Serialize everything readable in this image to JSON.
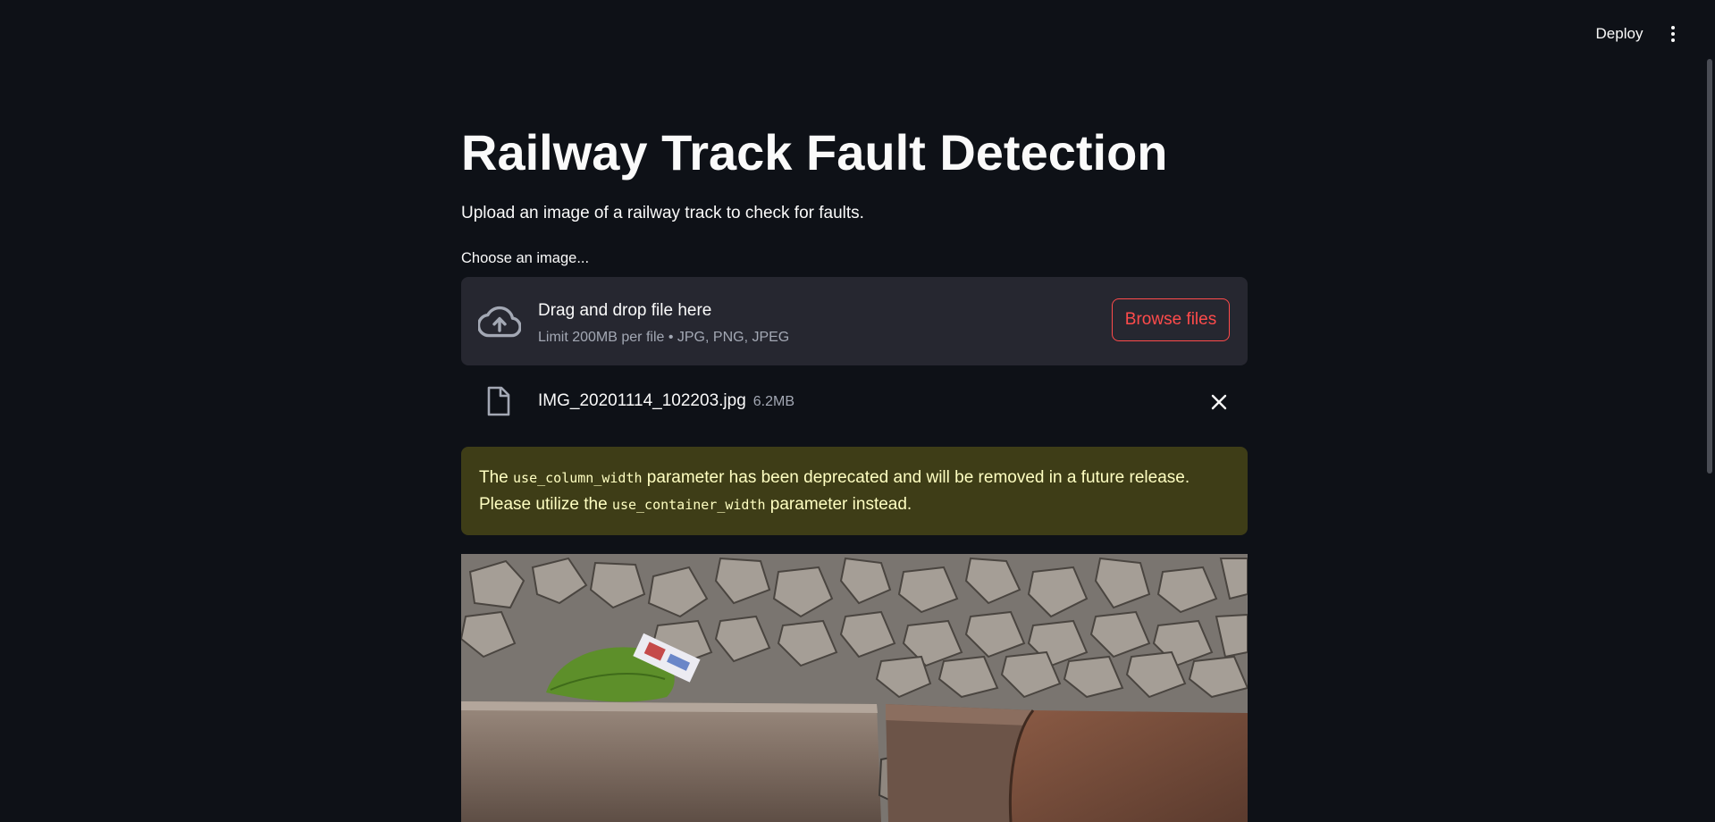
{
  "header": {
    "deploy_label": "Deploy",
    "menu_icon": "more-vertical-icon"
  },
  "page": {
    "title": "Railway Track Fault Detection",
    "subtitle": "Upload an image of a railway track to check for faults."
  },
  "uploader": {
    "label": "Choose an image...",
    "drop_title": "Drag and drop file here",
    "limit_text": "Limit 200MB per file • JPG, PNG, JPEG",
    "browse_label": "Browse files",
    "icon": "cloud-upload-icon",
    "file": {
      "name": "IMG_20201114_102203.jpg",
      "size": "6.2MB",
      "icon": "file-icon",
      "remove_icon": "close-icon"
    }
  },
  "warning": {
    "text_1": "The ",
    "code_1": "use_column_width",
    "text_2": " parameter has been deprecated and will be removed in a future release. Please utilize the ",
    "code_2": "use_container_width",
    "text_3": " parameter instead."
  },
  "colors": {
    "background": "#0e1117",
    "accent": "#ff4b4b",
    "dropzone": "#262730",
    "warning_bg": "#3e3d17",
    "warning_text": "#ffffc2"
  }
}
